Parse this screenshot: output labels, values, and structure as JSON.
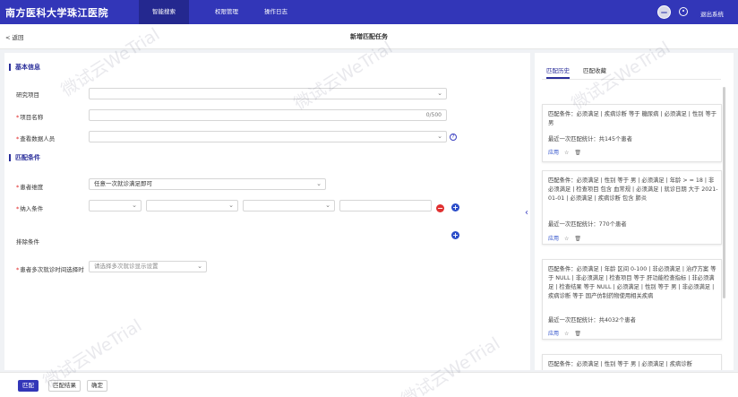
{
  "app": {
    "brand": "南方医科大学珠江医院",
    "nav": [
      "智能搜索",
      "权限管理",
      "操作日志"
    ],
    "logout": "退出系统"
  },
  "header": {
    "back": "< 返回",
    "title": "新增匹配任务"
  },
  "basic": {
    "section_title": "基本信息",
    "research_label": "研究项目",
    "task_name_label": "项目名称",
    "task_name_counter": "0/500",
    "reviewer_label": "查看数据人员"
  },
  "match": {
    "section_title": "匹配条件",
    "dimension_label": "患者维度",
    "dimension_value": "任意一次就诊满足即可",
    "include_label": "纳入条件",
    "exclude_label": "排除条件",
    "visit_label": "患者多次就诊时间选择时",
    "visit_placeholder": "请选择多次就诊显示设置"
  },
  "right": {
    "tab_history": "匹配历史",
    "tab_favorite": "匹配收藏",
    "cards": [
      {
        "cond_label": "匹配条件：",
        "cond_text": "必须满足 | 疾病诊断 等于 糖尿病 | 必须满足 | 性别 等于 男",
        "stat": "最近一次匹配统计：共145个患者",
        "use": "应用"
      },
      {
        "cond_label": "匹配条件：",
        "cond_text": "必须满足 | 性别 等于 男 | 必须满足 | 年龄 > = 18 | 非必须满足 | 检查项目 包含 血常规 | 必须满足 | 就诊日期 大于 2021-01-01 | 必须满足 | 疾病诊断 包含 肺炎",
        "stat": "最近一次匹配统计：770个患者",
        "use": "应用"
      },
      {
        "cond_label": "匹配条件：",
        "cond_text": "必须满足 | 年龄 区间 0-100 | 非必须满足 | 治疗方案 等于 NULL | 非必须满足 | 检查项目 等于 肝功能检查指标 | 非必须满足 | 检查结果 等于 NULL | 必须满足 | 性别 等于 男 | 非必须满足 | 疾病诊断 等于 国产仿制药物使用相关疾病",
        "stat": "最近一次匹配统计：共4032个患者",
        "use": "应用"
      },
      {
        "cond_label": "匹配条件：",
        "cond_text": "必须满足 | 性别 等于 男 | 必须满足 | 疾病诊断",
        "stat": "",
        "use": ""
      }
    ]
  },
  "footer": {
    "match": "匹配",
    "result": "匹配结果",
    "confirm": "确定"
  },
  "watermark": "微试云WeTrial"
}
